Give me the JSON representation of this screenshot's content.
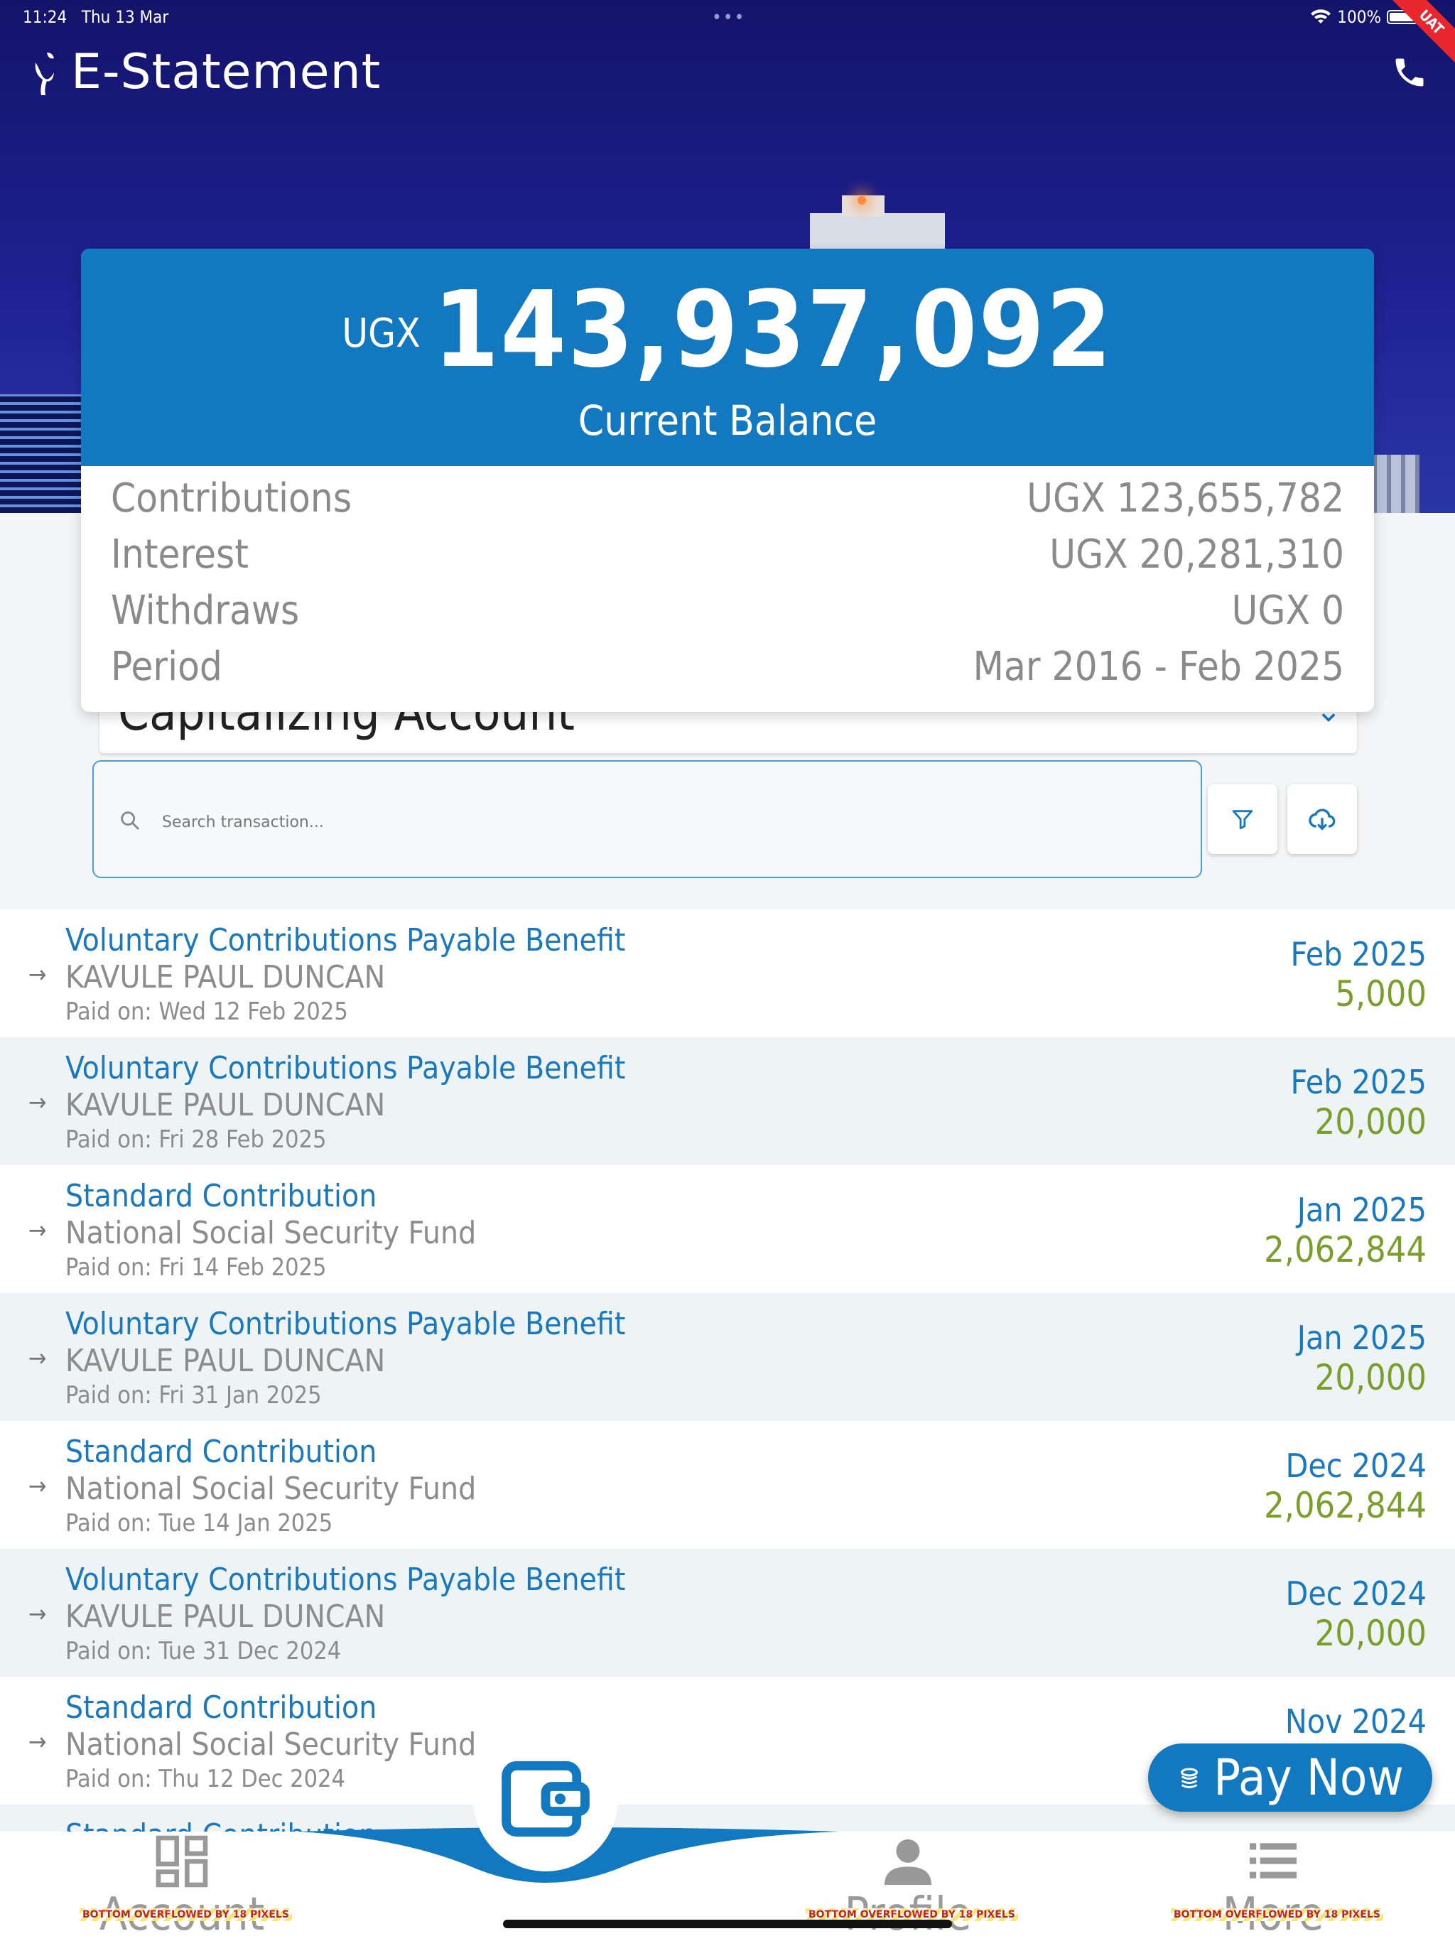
{
  "status_bar": {
    "time": "11:24",
    "date": "Thu 13 Mar",
    "battery": "100%",
    "ribbon": "UAT"
  },
  "header": {
    "title": "E-Statement"
  },
  "balance": {
    "currency": "UGX",
    "amount": "143,937,092",
    "label": "Current Balance",
    "summary": [
      {
        "label": "Contributions",
        "value": "UGX 123,655,782"
      },
      {
        "label": "Interest",
        "value": "UGX 20,281,310"
      },
      {
        "label": "Withdraws",
        "value": "UGX 0"
      },
      {
        "label": "Period",
        "value": "Mar 2016 - Feb 2025"
      }
    ]
  },
  "account_select": {
    "label": "Capitalizing Account"
  },
  "search": {
    "placeholder": "Search transaction..."
  },
  "transactions": [
    {
      "title": "Voluntary Contributions Payable Benefit",
      "name": "KAVULE PAUL DUNCAN",
      "paid": "Paid on: Wed 12 Feb 2025",
      "period": "Feb 2025",
      "amount": "5,000"
    },
    {
      "title": "Voluntary Contributions Payable Benefit",
      "name": "KAVULE PAUL DUNCAN",
      "paid": "Paid on: Fri 28 Feb 2025",
      "period": "Feb 2025",
      "amount": "20,000"
    },
    {
      "title": "Standard Contribution",
      "name": "National Social Security Fund",
      "paid": "Paid on: Fri 14 Feb 2025",
      "period": "Jan 2025",
      "amount": "2,062,844"
    },
    {
      "title": "Voluntary Contributions Payable Benefit",
      "name": "KAVULE PAUL DUNCAN",
      "paid": "Paid on: Fri 31 Jan 2025",
      "period": "Jan 2025",
      "amount": "20,000"
    },
    {
      "title": "Standard Contribution",
      "name": "National Social Security Fund",
      "paid": "Paid on: Tue 14 Jan 2025",
      "period": "Dec 2024",
      "amount": "2,062,844"
    },
    {
      "title": "Voluntary Contributions Payable Benefit",
      "name": "KAVULE PAUL DUNCAN",
      "paid": "Paid on: Tue 31 Dec 2024",
      "period": "Dec 2024",
      "amount": "20,000"
    },
    {
      "title": "Standard Contribution",
      "name": "National Social Security Fund",
      "paid": "Paid on: Thu 12 Dec 2024",
      "period": "Nov 2024",
      "amount": ""
    },
    {
      "title": "Standard Contribution",
      "name": "",
      "paid": "",
      "period": "",
      "amount": ""
    }
  ],
  "pay_now": {
    "label": "Pay Now"
  },
  "nav": {
    "items": [
      {
        "label": "Account",
        "icon": "grid-icon"
      },
      {
        "label": "Profile",
        "icon": "person-icon"
      },
      {
        "label": "More",
        "icon": "list-icon"
      }
    ],
    "center_icon": "wallet-icon",
    "overflow_text": "BOTTOM OVERFLOWED BY 18 PIXELS"
  },
  "colors": {
    "primary": "#1278c0",
    "amount_green": "#7a9e2a",
    "hero_bg": "#1e2191"
  }
}
